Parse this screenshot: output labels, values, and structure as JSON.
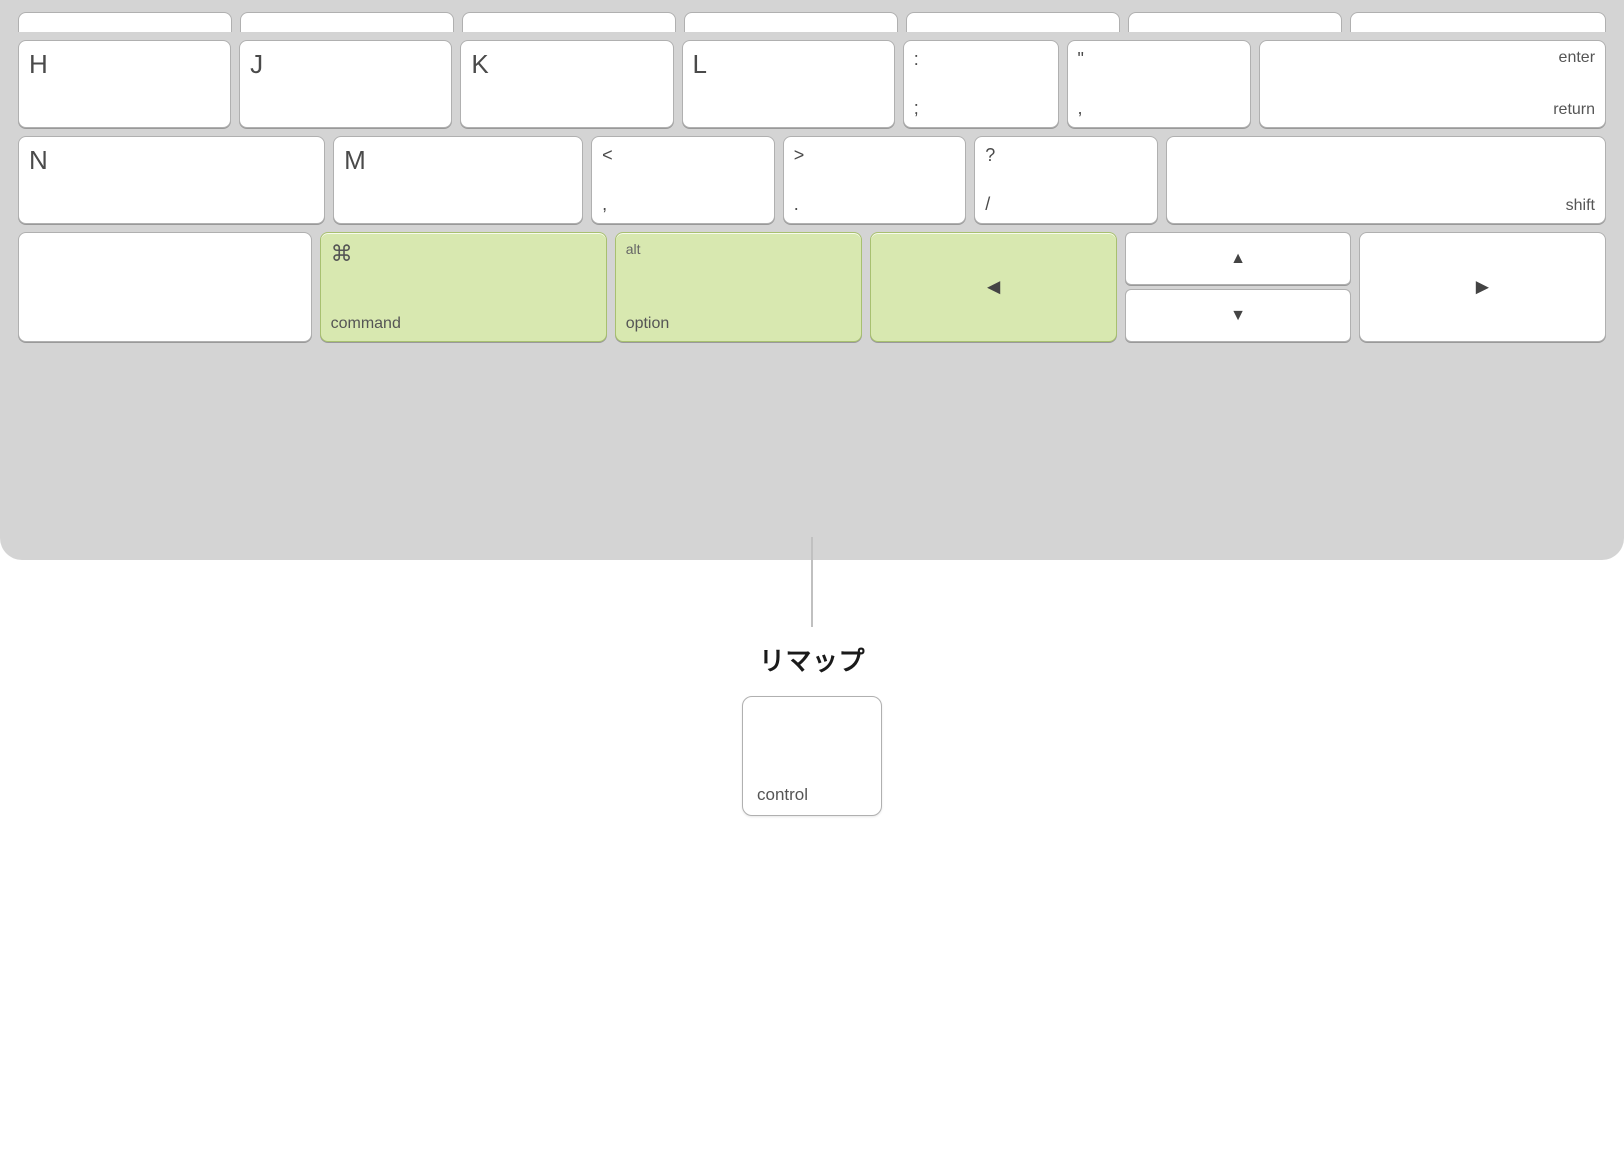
{
  "keyboard": {
    "background_color": "#d4d4d4",
    "highlight_color": "#d8e8b0",
    "row0": {
      "keys": [
        "partial1",
        "partial2",
        "partial3",
        "partial4",
        "partial5",
        "partial6",
        "backslash"
      ]
    },
    "row1": {
      "keys": [
        {
          "id": "h",
          "label": "H"
        },
        {
          "id": "j",
          "label": "J"
        },
        {
          "id": "k",
          "label": "K"
        },
        {
          "id": "l",
          "label": "L"
        },
        {
          "id": "semicolon",
          "top": ":",
          "bottom": ";"
        },
        {
          "id": "quote",
          "top": "“",
          "bottom": ","
        },
        {
          "id": "enter",
          "top": "enter",
          "bottom": "return"
        }
      ]
    },
    "row2": {
      "keys": [
        {
          "id": "n",
          "label": "N"
        },
        {
          "id": "m",
          "label": "M"
        },
        {
          "id": "comma",
          "top": "<",
          "bottom": ","
        },
        {
          "id": "period",
          "top": ">",
          "bottom": "."
        },
        {
          "id": "slash",
          "top": "?",
          "bottom": "/"
        },
        {
          "id": "shift",
          "label": "shift"
        }
      ]
    },
    "row3": {
      "command": {
        "icon": "⌘",
        "label": "command"
      },
      "option": {
        "top": "alt",
        "bottom": "option"
      },
      "left_arrow": "◄",
      "up_arrow": "▲",
      "down_arrow": "▼",
      "right_arrow": "►"
    }
  },
  "remap": {
    "label": "リマップ",
    "control_key_label": "control",
    "connector_color": "#c0c0c0"
  }
}
